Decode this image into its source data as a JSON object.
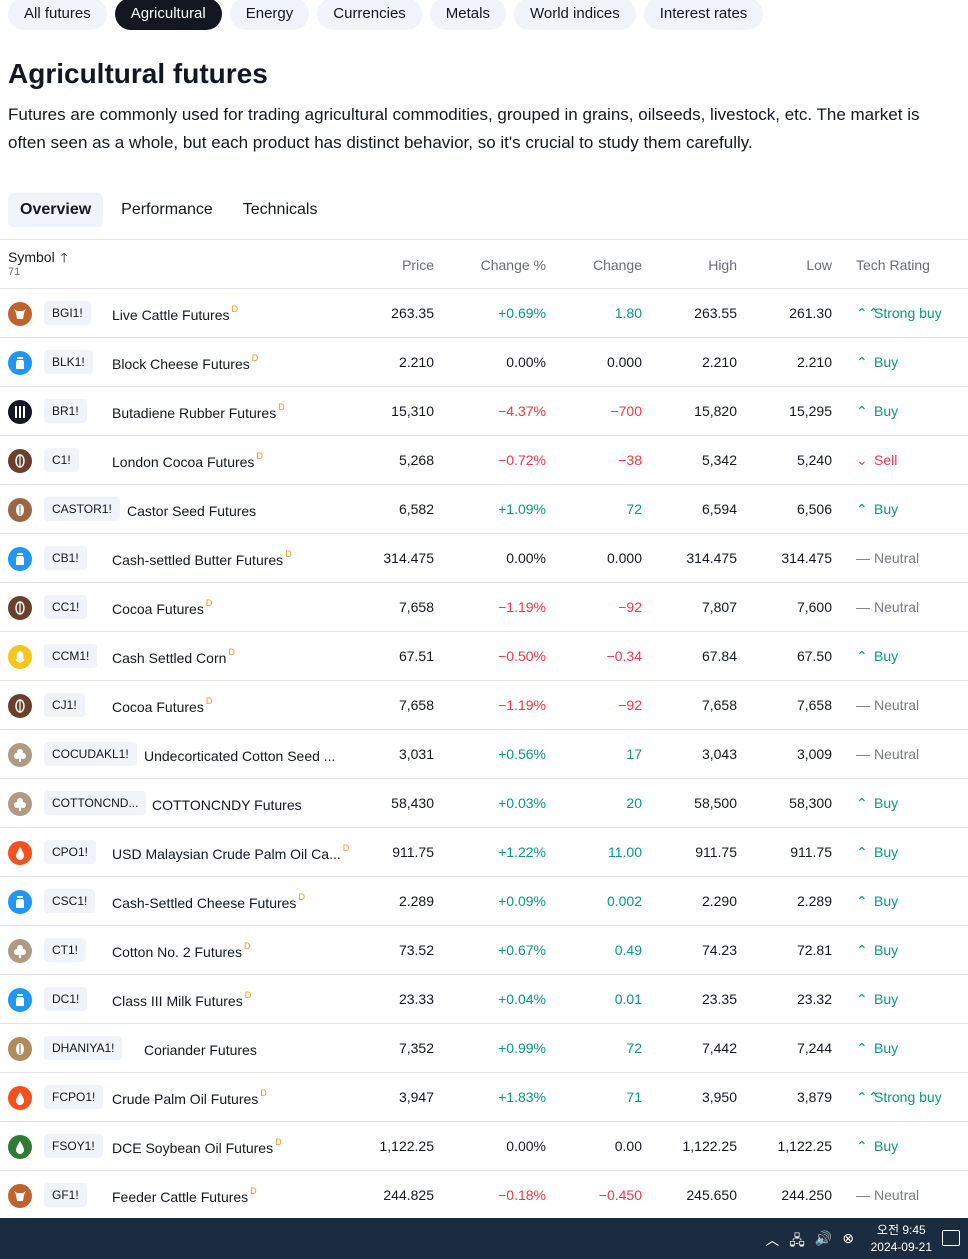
{
  "category_tabs": [
    {
      "label": "All futures",
      "active": false
    },
    {
      "label": "Agricultural",
      "active": true
    },
    {
      "label": "Energy",
      "active": false
    },
    {
      "label": "Currencies",
      "active": false
    },
    {
      "label": "Metals",
      "active": false
    },
    {
      "label": "World indices",
      "active": false
    },
    {
      "label": "Interest rates",
      "active": false
    }
  ],
  "page": {
    "title": "Agricultural futures",
    "description": "Futures are commonly used for trading agricultural commodities, grouped in grains, oilseeds, livestock, etc. The market is often seen as a whole, but each product has distinct behavior, so it's crucial to study them carefully."
  },
  "view_tabs": [
    {
      "label": "Overview",
      "active": true
    },
    {
      "label": "Performance",
      "active": false
    },
    {
      "label": "Technicals",
      "active": false
    }
  ],
  "table": {
    "headers": {
      "symbol": "Symbol",
      "count": "71",
      "price": "Price",
      "change_pct": "Change %",
      "change": "Change",
      "high": "High",
      "low": "Low",
      "rating": "Tech Rating"
    },
    "rows": [
      {
        "ticker": "BGI1!",
        "name": "Live Cattle Futures",
        "d": "D",
        "price": "263.35",
        "change_pct": "+0.69%",
        "change": "1.80",
        "high": "263.55",
        "low": "261.30",
        "rating": "Strong buy",
        "dir": "pos",
        "icon": "cattle-icon",
        "icon_color": "#c0622c"
      },
      {
        "ticker": "BLK1!",
        "name": "Block Cheese Futures",
        "d": "D",
        "price": "2.210",
        "change_pct": "0.00%",
        "change": "0.000",
        "high": "2.210",
        "low": "2.210",
        "rating": "Buy",
        "dir": "neu",
        "icon": "dairy-icon",
        "icon_color": "#2196f3"
      },
      {
        "ticker": "BR1!",
        "name": "Butadiene Rubber Futures",
        "d": "D",
        "price": "15,310",
        "change_pct": "−4.37%",
        "change": "−700",
        "high": "15,820",
        "low": "15,295",
        "rating": "Buy",
        "dir": "neg",
        "icon": "rubber-icon",
        "icon_color": "#131722"
      },
      {
        "ticker": "C1!",
        "name": "London Cocoa Futures",
        "d": "D",
        "price": "5,268",
        "change_pct": "−0.72%",
        "change": "−38",
        "high": "5,342",
        "low": "5,240",
        "rating": "Sell",
        "dir": "neg",
        "icon": "cocoa-icon",
        "icon_color": "#6b3f2a"
      },
      {
        "ticker": "CASTOR1!",
        "name": "Castor Seed Futures",
        "d": "",
        "price": "6,582",
        "change_pct": "+1.09%",
        "change": "72",
        "high": "6,594",
        "low": "6,506",
        "rating": "Buy",
        "dir": "pos",
        "icon": "seed-icon",
        "icon_color": "#9c6644"
      },
      {
        "ticker": "CB1!",
        "name": "Cash-settled Butter Futures",
        "d": "D",
        "price": "314.475",
        "change_pct": "0.00%",
        "change": "0.000",
        "high": "314.475",
        "low": "314.475",
        "rating": "Neutral",
        "dir": "neu",
        "icon": "dairy-icon",
        "icon_color": "#2196f3"
      },
      {
        "ticker": "CC1!",
        "name": "Cocoa Futures",
        "d": "D",
        "price": "7,658",
        "change_pct": "−1.19%",
        "change": "−92",
        "high": "7,807",
        "low": "7,600",
        "rating": "Neutral",
        "dir": "neg",
        "icon": "cocoa-icon",
        "icon_color": "#6b3f2a"
      },
      {
        "ticker": "CCM1!",
        "name": "Cash Settled Corn",
        "d": "D",
        "price": "67.51",
        "change_pct": "−0.50%",
        "change": "−0.34",
        "high": "67.84",
        "low": "67.50",
        "rating": "Buy",
        "dir": "neg",
        "icon": "corn-icon",
        "icon_color": "#f5c518"
      },
      {
        "ticker": "CJ1!",
        "name": "Cocoa Futures",
        "d": "D",
        "price": "7,658",
        "change_pct": "−1.19%",
        "change": "−92",
        "high": "7,658",
        "low": "7,658",
        "rating": "Neutral",
        "dir": "neg",
        "icon": "cocoa-icon",
        "icon_color": "#6b3f2a"
      },
      {
        "ticker": "COCUDAKL1!",
        "name": "Undecorticated Cotton Seed ...",
        "d": "",
        "price": "3,031",
        "change_pct": "+0.56%",
        "change": "17",
        "high": "3,043",
        "low": "3,009",
        "rating": "Neutral",
        "dir": "pos",
        "icon": "cotton-icon",
        "icon_color": "#b09a86"
      },
      {
        "ticker": "COTTONCND...",
        "name": "COTTONCNDY Futures",
        "d": "",
        "price": "58,430",
        "change_pct": "+0.03%",
        "change": "20",
        "high": "58,500",
        "low": "58,300",
        "rating": "Buy",
        "dir": "pos",
        "icon": "cotton-icon",
        "icon_color": "#b09a86"
      },
      {
        "ticker": "CPO1!",
        "name": "USD Malaysian Crude Palm Oil Ca...",
        "d": "D",
        "price": "911.75",
        "change_pct": "+1.22%",
        "change": "11.00",
        "high": "911.75",
        "low": "911.75",
        "rating": "Buy",
        "dir": "pos",
        "icon": "oil-drop-icon",
        "icon_color": "#f4511e"
      },
      {
        "ticker": "CSC1!",
        "name": "Cash-Settled Cheese Futures",
        "d": "D",
        "price": "2.289",
        "change_pct": "+0.09%",
        "change": "0.002",
        "high": "2.290",
        "low": "2.289",
        "rating": "Buy",
        "dir": "pos",
        "icon": "dairy-icon",
        "icon_color": "#2196f3"
      },
      {
        "ticker": "CT1!",
        "name": "Cotton No. 2 Futures",
        "d": "D",
        "price": "73.52",
        "change_pct": "+0.67%",
        "change": "0.49",
        "high": "74.23",
        "low": "72.81",
        "rating": "Buy",
        "dir": "pos",
        "icon": "cotton-icon",
        "icon_color": "#b09a86"
      },
      {
        "ticker": "DC1!",
        "name": "Class III Milk Futures",
        "d": "D",
        "price": "23.33",
        "change_pct": "+0.04%",
        "change": "0.01",
        "high": "23.35",
        "low": "23.32",
        "rating": "Buy",
        "dir": "pos",
        "icon": "dairy-icon",
        "icon_color": "#2196f3"
      },
      {
        "ticker": "DHANIYA1!",
        "name": "Coriander Futures",
        "d": "",
        "price": "7,352",
        "change_pct": "+0.99%",
        "change": "72",
        "high": "7,442",
        "low": "7,244",
        "rating": "Buy",
        "dir": "pos",
        "icon": "seed-icon",
        "icon_color": "#b08a5a"
      },
      {
        "ticker": "FCPO1!",
        "name": "Crude Palm Oil Futures",
        "d": "D",
        "price": "3,947",
        "change_pct": "+1.83%",
        "change": "71",
        "high": "3,950",
        "low": "3,879",
        "rating": "Strong buy",
        "dir": "pos",
        "icon": "oil-drop-icon",
        "icon_color": "#f4511e"
      },
      {
        "ticker": "FSOY1!",
        "name": "DCE Soybean Oil Futures",
        "d": "D",
        "price": "1,122.25",
        "change_pct": "0.00%",
        "change": "0.00",
        "high": "1,122.25",
        "low": "1,122.25",
        "rating": "Buy",
        "dir": "neu",
        "icon": "soy-icon",
        "icon_color": "#2e7d32"
      },
      {
        "ticker": "GF1!",
        "name": "Feeder Cattle Futures",
        "d": "D",
        "price": "244.825",
        "change_pct": "−0.18%",
        "change": "−0.450",
        "high": "245.650",
        "low": "244.250",
        "rating": "Neutral",
        "dir": "neg",
        "icon": "cattle-icon",
        "icon_color": "#c0622c"
      }
    ]
  },
  "taskbar": {
    "time": "오전 9:45",
    "date": "2024-09-21"
  }
}
